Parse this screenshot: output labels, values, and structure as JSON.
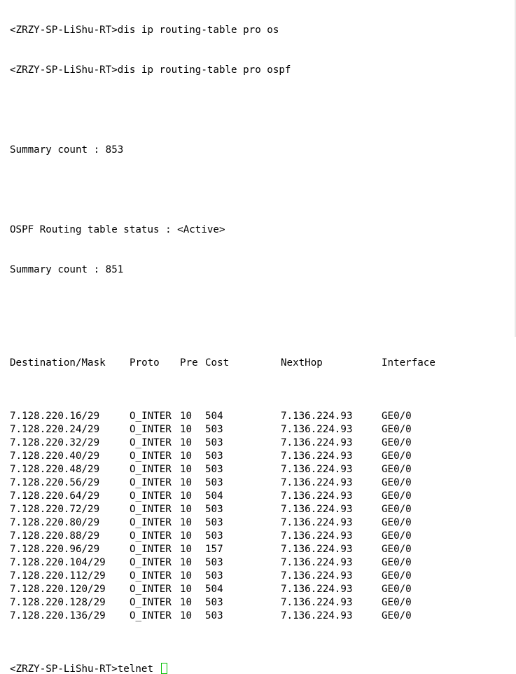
{
  "terminal": {
    "top_partial_line": "<ZRZY-SP-LiShu-RT>dis ip routing-table pro os",
    "command_prompt": "<ZRZY-SP-LiShu-RT>dis ip routing-table pro ospf",
    "summary_count_total": "Summary count : 853",
    "status_line": "OSPF Routing table status : <Active>",
    "summary_count_active": "Summary count : 851",
    "columns": [
      "Destination/Mask",
      "Proto",
      "Pre",
      "Cost",
      "NextHop",
      "Interface"
    ],
    "rows": [
      [
        "7.128.220.16/29",
        "O_INTER",
        "10",
        "504",
        "7.136.224.93",
        "GE0/0"
      ],
      [
        "7.128.220.24/29",
        "O_INTER",
        "10",
        "503",
        "7.136.224.93",
        "GE0/0"
      ],
      [
        "7.128.220.32/29",
        "O_INTER",
        "10",
        "503",
        "7.136.224.93",
        "GE0/0"
      ],
      [
        "7.128.220.40/29",
        "O_INTER",
        "10",
        "503",
        "7.136.224.93",
        "GE0/0"
      ],
      [
        "7.128.220.48/29",
        "O_INTER",
        "10",
        "503",
        "7.136.224.93",
        "GE0/0"
      ],
      [
        "7.128.220.56/29",
        "O_INTER",
        "10",
        "503",
        "7.136.224.93",
        "GE0/0"
      ],
      [
        "7.128.220.64/29",
        "O_INTER",
        "10",
        "504",
        "7.136.224.93",
        "GE0/0"
      ],
      [
        "7.128.220.72/29",
        "O_INTER",
        "10",
        "503",
        "7.136.224.93",
        "GE0/0"
      ],
      [
        "7.128.220.80/29",
        "O_INTER",
        "10",
        "503",
        "7.136.224.93",
        "GE0/0"
      ],
      [
        "7.128.220.88/29",
        "O_INTER",
        "10",
        "503",
        "7.136.224.93",
        "GE0/0"
      ],
      [
        "7.128.220.96/29",
        "O_INTER",
        "10",
        "157",
        "7.136.224.93",
        "GE0/0"
      ],
      [
        "7.128.220.104/29",
        "O_INTER",
        "10",
        "503",
        "7.136.224.93",
        "GE0/0"
      ],
      [
        "7.128.220.112/29",
        "O_INTER",
        "10",
        "503",
        "7.136.224.93",
        "GE0/0"
      ],
      [
        "7.128.220.120/29",
        "O_INTER",
        "10",
        "504",
        "7.136.224.93",
        "GE0/0"
      ],
      [
        "7.128.220.128/29",
        "O_INTER",
        "10",
        "503",
        "7.136.224.93",
        "GE0/0"
      ],
      [
        "7.128.220.136/29",
        "O_INTER",
        "10",
        "503",
        "7.136.224.93",
        "GE0/0"
      ]
    ],
    "input_prompt": "<ZRZY-SP-LiShu-RT>",
    "input_value": "telnet ",
    "cursor_color": "#00c000"
  }
}
